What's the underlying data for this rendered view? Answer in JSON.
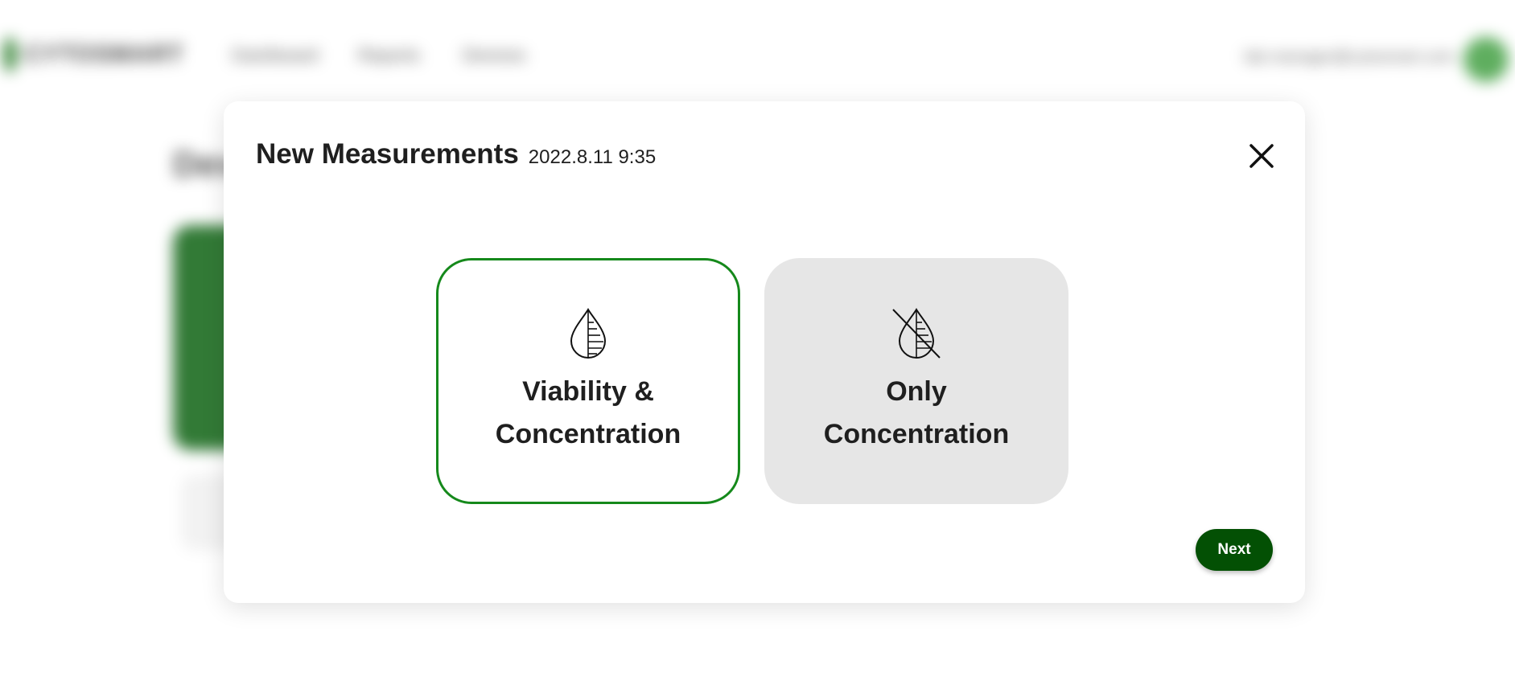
{
  "background": {
    "logo_text": "CYTOSMART",
    "nav": [
      "Dashboard",
      "Reports",
      "Devices"
    ],
    "user_email": "lab.manager@cytosmart.com",
    "page_heading": "Devices"
  },
  "modal": {
    "title": "New Measurements",
    "timestamp": "2022.8.11 9:35",
    "options": [
      {
        "line1": "Viability &",
        "line2": "Concentration",
        "icon": "droplet-gauge-icon",
        "selected": true
      },
      {
        "line1": "Only",
        "line2": "Concentration",
        "icon": "droplet-crossed-icon",
        "selected": false
      }
    ],
    "next_label": "Next"
  },
  "colors": {
    "accent_green": "#15891b",
    "button_green": "#035004",
    "unselected_card": "#e6e6e6"
  }
}
